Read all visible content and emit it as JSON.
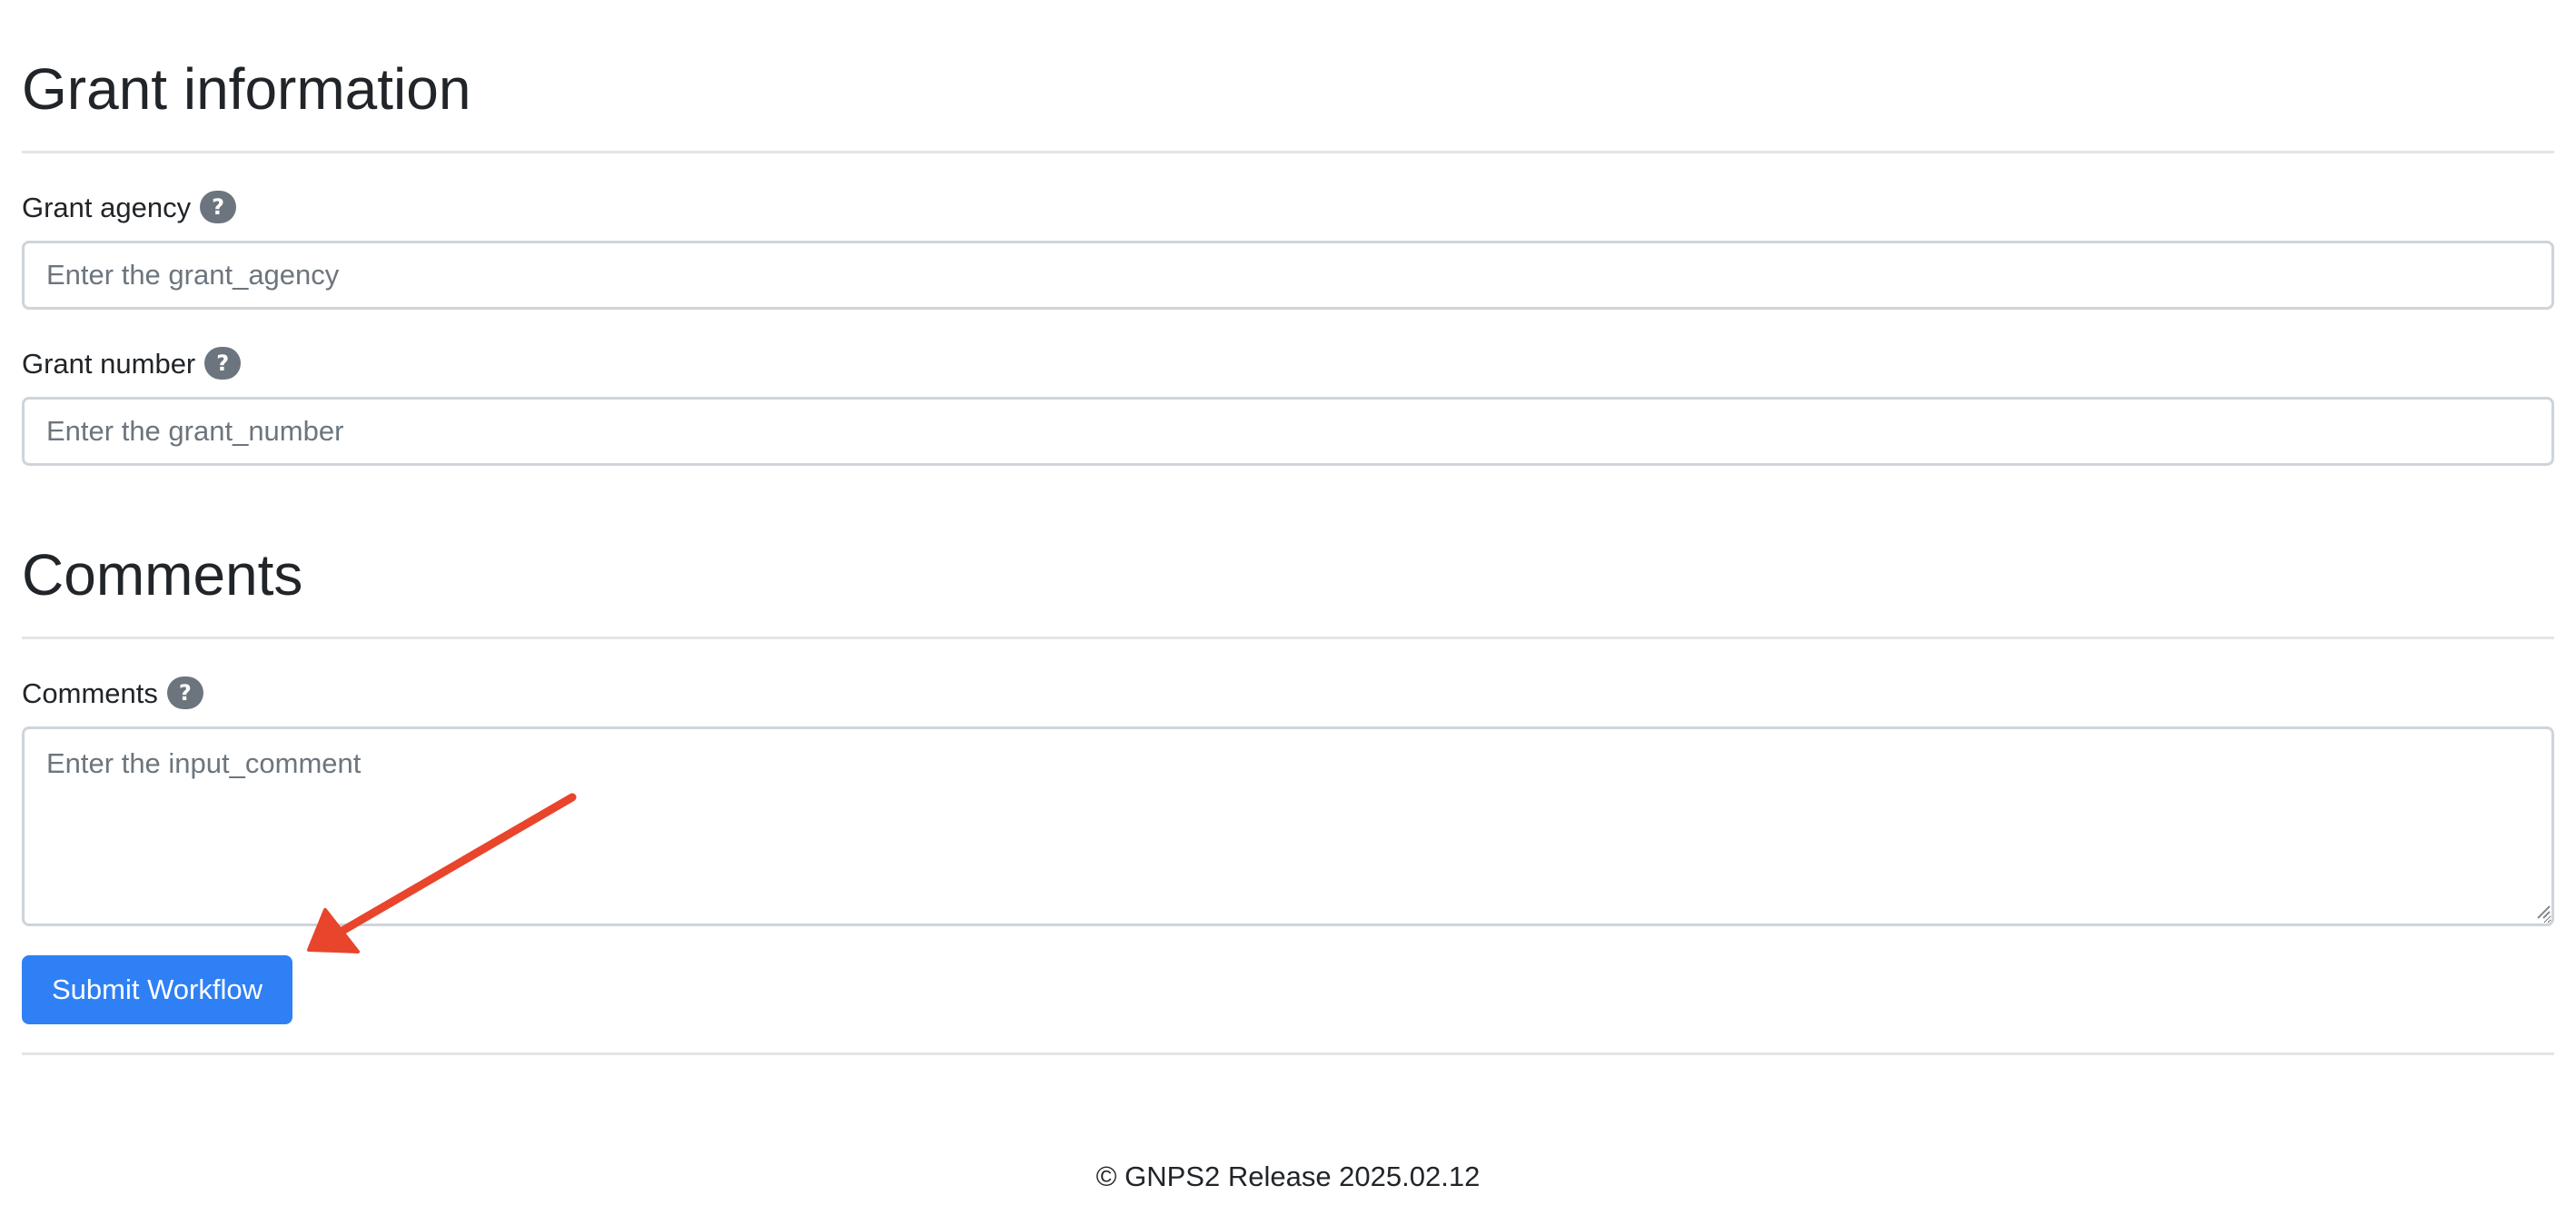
{
  "grant_section": {
    "title": "Grant information",
    "agency_label": "Grant agency",
    "agency_placeholder": "Enter the grant_agency",
    "number_label": "Grant number",
    "number_placeholder": "Enter the grant_number"
  },
  "comments_section": {
    "title": "Comments",
    "comments_label": "Comments",
    "comments_placeholder": "Enter the input_comment"
  },
  "help_badge_text": "?",
  "submit_button_label": "Submit Workflow",
  "footer_text": "© GNPS2 Release 2025.02.12",
  "colors": {
    "primary_button": "#2f80f5",
    "help_badge": "#6c757d",
    "annotation_arrow": "#e8452c"
  },
  "icons": {
    "help": "question-circle-icon",
    "annotation": "red-arrow-annotation"
  }
}
